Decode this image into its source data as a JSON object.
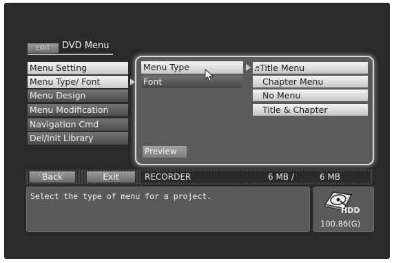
{
  "header": {
    "edit_tag": "EDIT",
    "title": "DVD Menu"
  },
  "sidebar": {
    "items": [
      {
        "label": "Menu Setting"
      },
      {
        "label": "Menu Type/ Font"
      },
      {
        "label": "Menu Design"
      },
      {
        "label": "Menu Modification"
      },
      {
        "label": "Navigation Cmd"
      },
      {
        "label": "Del/Init Library"
      }
    ],
    "selected_index": 1
  },
  "submenu": {
    "items": [
      {
        "label": "Menu Type"
      },
      {
        "label": "Font"
      }
    ],
    "highlighted_index": 0,
    "preview_label": "Preview"
  },
  "options": {
    "items": [
      {
        "label": "Title Menu",
        "checked": true
      },
      {
        "label": "Chapter Menu",
        "checked": false
      },
      {
        "label": "No Menu",
        "checked": false
      },
      {
        "label": "Title & Chapter",
        "checked": false
      }
    ],
    "check_glyph": "♬"
  },
  "bottom_bar": {
    "back_label": "Back",
    "exit_label": "Exit",
    "source_label": "RECORDER",
    "used_size": "6 MB /",
    "total_size": "6 MB"
  },
  "message": {
    "text": "Select the type of menu for a project."
  },
  "storage": {
    "device_label": "HDD",
    "capacity": "100.86(G)"
  },
  "icons": {
    "cursor": "mouse-pointer-icon",
    "disk": "hard-disk-icon",
    "arrow": "triangle-right-icon"
  },
  "colors": {
    "background": "#2a2a2a",
    "panel": "#5b5b5b",
    "item_light": "#e6e6e6",
    "item_dark": "#595959"
  }
}
